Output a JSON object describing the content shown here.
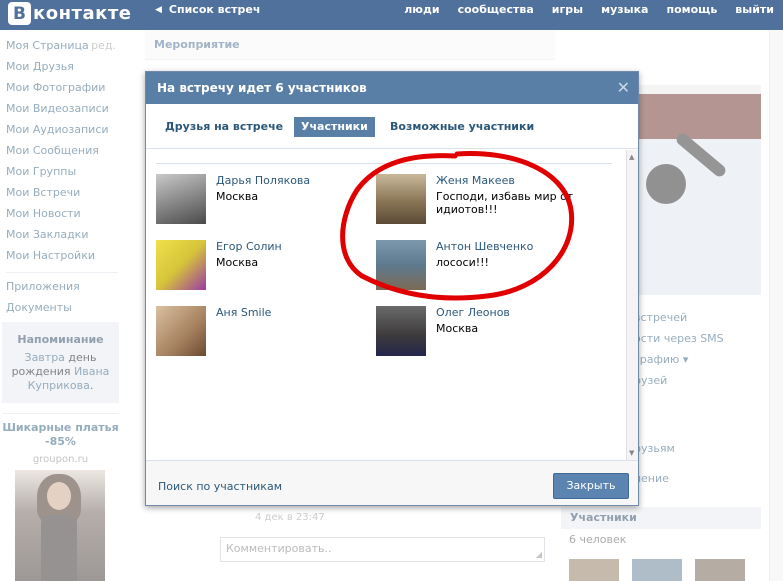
{
  "topbar": {
    "logo_letter": "B",
    "logo_text": "контакте",
    "back_link": "Список встреч",
    "nav": [
      "люди",
      "сообщества",
      "игры",
      "музыка",
      "помощь",
      "выйти"
    ]
  },
  "sidebar": {
    "items": [
      {
        "label": "Моя Страница",
        "edit": "ред."
      },
      {
        "label": "Мои Друзья"
      },
      {
        "label": "Мои Фотографии"
      },
      {
        "label": "Мои Видеозаписи"
      },
      {
        "label": "Мои Аудиозаписи"
      },
      {
        "label": "Мои Сообщения"
      },
      {
        "label": "Мои Группы"
      },
      {
        "label": "Мои Встречи"
      },
      {
        "label": "Мои Новости"
      },
      {
        "label": "Мои Закладки"
      },
      {
        "label": "Мои Настройки"
      }
    ],
    "extra_items": [
      "Приложения",
      "Документы"
    ],
    "reminder": {
      "title": "Напоминание",
      "line1_link": "Завтра",
      "line1_text": " день",
      "line2_text": "рождения ",
      "line2_link": "Ивана",
      "line3_link": "Куприкова",
      "line3_text": "."
    },
    "ad": {
      "title": "Шикарные платья -85%",
      "source": "groupon.ru"
    }
  },
  "main": {
    "header": "Мероприятие",
    "post_date": "4 дек в 23:47",
    "comment_placeholder": "Комментировать.."
  },
  "right": {
    "links": [
      "встречей",
      "ости через SMS",
      "графию ▾",
      "рузей",
      "рузьям",
      "ление"
    ],
    "members_title": "Участники",
    "members_count": "6 человек"
  },
  "modal": {
    "title": "На встречу идет 6 участников",
    "close": "✕",
    "tabs": [
      {
        "label": "Друзья на встрече",
        "active": false
      },
      {
        "label": "Участники",
        "active": true
      },
      {
        "label": "Возможные участники",
        "active": false
      }
    ],
    "members": [
      {
        "name": "Дарья Полякова",
        "status": "Москва",
        "avatar_color": "#7a7a7a"
      },
      {
        "name": "Женя Макеев",
        "status": "Господи, избавь мир от идиотов!!!",
        "avatar_color": "#8a7556"
      },
      {
        "name": "Егор Солин",
        "status": "Москва",
        "avatar_color": "#d6c43a"
      },
      {
        "name": "Антон Шевченко",
        "status": "лососи!!!",
        "avatar_color": "#5d7a8e"
      },
      {
        "name": "Аня Smile",
        "status": "",
        "avatar_color": "#a5805e"
      },
      {
        "name": "Олег Леонов",
        "status": "Москва",
        "avatar_color": "#3d3a3c"
      }
    ],
    "search_link": "Поиск по участникам",
    "close_button": "Закрыть"
  }
}
